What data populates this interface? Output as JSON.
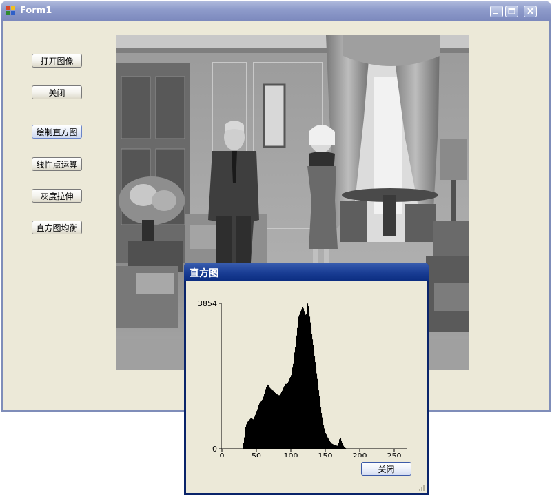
{
  "window": {
    "title": "Form1",
    "buttons": [
      {
        "id": "open-image",
        "label": "打开图像"
      },
      {
        "id": "close",
        "label": "关闭"
      },
      {
        "id": "draw-histogram",
        "label": "绘制直方图"
      },
      {
        "id": "linear-point-op",
        "label": "线性点运算"
      },
      {
        "id": "gray-stretch",
        "label": "灰度拉伸"
      },
      {
        "id": "histogram-equalize",
        "label": "直方图均衡"
      }
    ],
    "active_button": "draw-histogram",
    "icons": [
      "app-icon",
      "minimize-icon",
      "maximize-icon",
      "close-icon"
    ],
    "photo": {
      "kind": "grayscale photograph",
      "tone": "grayscale"
    }
  },
  "histogram_dialog": {
    "title": "直方图",
    "close_label": "关闭",
    "chart_data": {
      "type": "bar",
      "title": "",
      "xlabel": "",
      "ylabel": "",
      "xlim": [
        0,
        255
      ],
      "ylim": [
        0,
        3854
      ],
      "x_ticks": [
        0,
        50,
        100,
        150,
        200,
        250
      ],
      "y_ticks": [
        0,
        3854
      ],
      "bar_color": "#000000",
      "grid": false,
      "bins": [
        0,
        0,
        0,
        0,
        0,
        0,
        0,
        0,
        0,
        0,
        0,
        0,
        0,
        0,
        0,
        0,
        0,
        0,
        0,
        0,
        0,
        0,
        0,
        0,
        0,
        0,
        0,
        0,
        0,
        0,
        60,
        150,
        300,
        450,
        580,
        650,
        700,
        720,
        750,
        760,
        780,
        800,
        810,
        800,
        790,
        780,
        800,
        850,
        900,
        950,
        1000,
        1050,
        1100,
        1150,
        1200,
        1220,
        1250,
        1280,
        1300,
        1310,
        1380,
        1450,
        1520,
        1580,
        1640,
        1680,
        1700,
        1680,
        1650,
        1620,
        1600,
        1580,
        1560,
        1550,
        1540,
        1520,
        1500,
        1480,
        1460,
        1450,
        1440,
        1430,
        1420,
        1420,
        1440,
        1470,
        1500,
        1540,
        1580,
        1620,
        1660,
        1700,
        1720,
        1720,
        1730,
        1750,
        1780,
        1820,
        1860,
        1900,
        1950,
        2050,
        2150,
        2250,
        2400,
        2550,
        2700,
        2850,
        3000,
        3200,
        3400,
        3500,
        3550,
        3600,
        3650,
        3700,
        3750,
        3780,
        3720,
        3650,
        3600,
        3550,
        3580,
        3700,
        3850,
        3780,
        3650,
        3500,
        3350,
        3200,
        3050,
        2900,
        2750,
        2600,
        2450,
        2300,
        2150,
        2000,
        1850,
        1700,
        1550,
        1400,
        1250,
        1100,
        950,
        830,
        720,
        620,
        540,
        470,
        420,
        380,
        340,
        300,
        270,
        240,
        210,
        180,
        160,
        140,
        130,
        120,
        110,
        100,
        95,
        90,
        85,
        80,
        80,
        150,
        250,
        300,
        280,
        220,
        160,
        110,
        80,
        50,
        30,
        20,
        10,
        5,
        0,
        0,
        0,
        0,
        0,
        0,
        0,
        0,
        0,
        0,
        0,
        0,
        0,
        0,
        0,
        0,
        0,
        0,
        0,
        0,
        0,
        0,
        0,
        0,
        0,
        0,
        0,
        0,
        0,
        0,
        0,
        0,
        0,
        0,
        0,
        0,
        0,
        0,
        0,
        0,
        0,
        0,
        0,
        0,
        0,
        0,
        0,
        0,
        0,
        0,
        0,
        0,
        0,
        0,
        0,
        0,
        0,
        0,
        0,
        0,
        0,
        0,
        0,
        0,
        0,
        0,
        0,
        0,
        0,
        0,
        0,
        0,
        0,
        0,
        0,
        0,
        0,
        0,
        0,
        0,
        0,
        0,
        0,
        0
      ]
    }
  }
}
